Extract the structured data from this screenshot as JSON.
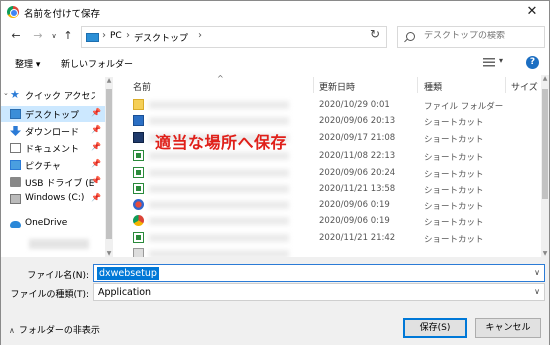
{
  "window": {
    "title": "名前を付けて保存",
    "close_glyph": "✕"
  },
  "addressbar": {
    "crumbs": [
      "PC",
      "デスクトップ"
    ],
    "search_placeholder": "デスクトップの検索"
  },
  "toolbar": {
    "organize": "整理 ▾",
    "new_folder": "新しいフォルダー"
  },
  "nav": {
    "items": [
      {
        "label": "クイック アクセス",
        "icon": "star-icon"
      },
      {
        "label": "デスクトップ",
        "icon": "desktop-icon",
        "pinned": true
      },
      {
        "label": "ダウンロード",
        "icon": "download-icon",
        "pinned": true
      },
      {
        "label": "ドキュメント",
        "icon": "document-icon",
        "pinned": true
      },
      {
        "label": "ピクチャ",
        "icon": "picture-icon",
        "pinned": true
      },
      {
        "label": "USB ドライブ (E",
        "icon": "usb-drive-icon",
        "pinned": true
      },
      {
        "label": "Windows (C:)",
        "icon": "windows-drive-icon",
        "pinned": true
      },
      {
        "label": "OneDrive",
        "icon": "onedrive-icon"
      }
    ]
  },
  "columns": {
    "name": "名前",
    "modified": "更新日時",
    "type": "種類",
    "size": "サイズ"
  },
  "files": [
    {
      "date": "2020/10/29 0:01",
      "type": "ファイル フォルダー",
      "icon": "folder"
    },
    {
      "date": "2020/09/06 20:13",
      "type": "ショートカット",
      "icon": "shortcut-blue"
    },
    {
      "date": "2020/09/17 21:08",
      "type": "ショートカット",
      "icon": "shortcut-dark"
    },
    {
      "date": "2020/11/08 22:13",
      "type": "ショートカット",
      "icon": "shortcut-green"
    },
    {
      "date": "2020/09/06 20:24",
      "type": "ショートカット",
      "icon": "shortcut-green"
    },
    {
      "date": "2020/11/21 13:58",
      "type": "ショートカット",
      "icon": "shortcut-green"
    },
    {
      "date": "2020/09/06 0:19",
      "type": "ショートカット",
      "icon": "shortcut-red"
    },
    {
      "date": "2020/09/06 0:19",
      "type": "ショートカット",
      "icon": "shortcut-chrome"
    },
    {
      "date": "2020/11/21 21:42",
      "type": "ショートカット",
      "icon": "shortcut-green"
    }
  ],
  "annotation": "適当な場所へ保存",
  "form": {
    "filename_label": "ファイル名(N):",
    "filename_value": "dxwebsetup",
    "filetype_label": "ファイルの種類(T):",
    "filetype_value": "Application",
    "hide_folders": "フォルダーの非表示",
    "save_button": "保存(S)",
    "cancel_button": "キャンセル"
  },
  "colors": {
    "accent": "#0078d7",
    "annotation": "#e0201a",
    "selected_nav": "#cce8ff"
  }
}
